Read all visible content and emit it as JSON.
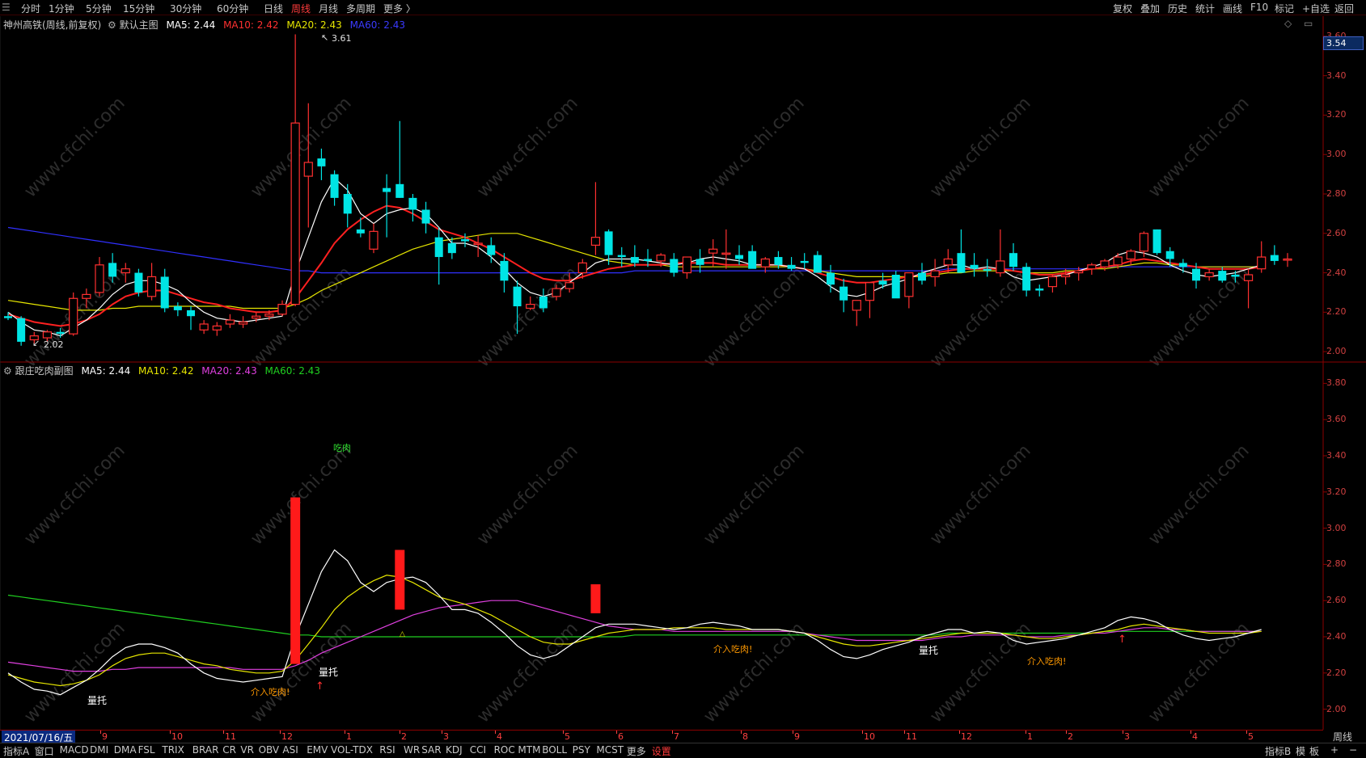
{
  "topbar": {
    "items": [
      "分时",
      "1分钟",
      "5分钟",
      "15分钟",
      "30分钟",
      "60分钟",
      "日线",
      "周线",
      "月线",
      "多周期",
      "更多 〉"
    ],
    "active": "周线",
    "right_items": [
      "复权",
      "叠加",
      "历史",
      "统计",
      "画线",
      "F10",
      "标记",
      "+自选",
      "返回"
    ]
  },
  "main_panel": {
    "stock": "神州高铁(周线,前复权)",
    "template": "默认主图",
    "ma5": "MA5: 2.44",
    "ma10": "MA10: 2.42",
    "ma20": "MA20: 2.43",
    "ma60": "MA60: 2.43",
    "high_label": "3.61",
    "low_label": "2.02",
    "price_tag": "3.54",
    "y_ticks": [
      "3.60",
      "3.40",
      "3.20",
      "3.00",
      "2.80",
      "2.60",
      "2.40",
      "2.20",
      "2.00"
    ]
  },
  "sub_panel": {
    "title": "跟庄吃肉副图",
    "ma5": "MA5: 2.44",
    "ma10": "MA10: 2.42",
    "ma20": "MA20: 2.43",
    "ma60": "MA60: 2.43",
    "y_ticks": [
      "3.80",
      "3.60",
      "3.40",
      "3.20",
      "3.00",
      "2.80",
      "2.60",
      "2.40",
      "2.20",
      "2.00"
    ],
    "annotations": {
      "chirou": "吃肉",
      "liangtuo1": "量托",
      "liangtuo2": "量托",
      "liangtuo3": "量托",
      "jieru1": "介入吃肉!",
      "jieru2": "介入吃肉!",
      "jieru3": "介入吃肉!"
    }
  },
  "date_axis": {
    "start_date": "2021/07/16/五",
    "ticks": [
      "9",
      "10",
      "11",
      "12",
      "1",
      "2",
      "3",
      "4",
      "5",
      "6",
      "7",
      "8",
      "9",
      "10",
      "11",
      "12",
      "1",
      "2",
      "3",
      "4",
      "5"
    ],
    "period_label": "周线"
  },
  "bottombar": {
    "items": [
      "指标A",
      "窗口",
      "MACD",
      "DMI",
      "DMA",
      "FSL",
      "TRIX",
      "BRAR",
      "CR",
      "VR",
      "OBV",
      "ASI",
      "EMV",
      "VOL-TDX",
      "RSI",
      "WR",
      "SAR",
      "KDJ",
      "CCI",
      "ROC",
      "MTM",
      "BOLL",
      "PSY",
      "MCST",
      "更多",
      "设置"
    ],
    "active": "设置",
    "right_items": [
      "指标B",
      "模",
      "板",
      "+",
      "−"
    ]
  },
  "watermark": "www.cfchi.com",
  "colors": {
    "up": "#ff3030",
    "down": "#00e5e5",
    "ma5": "#ffffff",
    "ma10_main": "#ff2020",
    "ma20_main": "#e6e600",
    "ma60_main": "#3030ff",
    "sub_ma10": "#e6e600",
    "sub_ma20": "#e040e0",
    "sub_ma60": "#20d020",
    "orange": "#ff9900"
  },
  "chart_data": {
    "type": "candlestick",
    "ylim_main": [
      1.98,
      3.62
    ],
    "candles": [
      [
        2.18,
        2.2,
        2.16,
        2.17
      ],
      [
        2.17,
        2.18,
        2.03,
        2.05
      ],
      [
        2.06,
        2.1,
        2.04,
        2.08
      ],
      [
        2.07,
        2.11,
        2.05,
        2.1
      ],
      [
        2.1,
        2.12,
        2.07,
        2.09
      ],
      [
        2.09,
        2.3,
        2.08,
        2.27
      ],
      [
        2.27,
        2.32,
        2.22,
        2.29
      ],
      [
        2.3,
        2.48,
        2.28,
        2.44
      ],
      [
        2.45,
        2.5,
        2.35,
        2.38
      ],
      [
        2.4,
        2.45,
        2.35,
        2.42
      ],
      [
        2.4,
        2.42,
        2.28,
        2.3
      ],
      [
        2.28,
        2.45,
        2.26,
        2.38
      ],
      [
        2.38,
        2.42,
        2.2,
        2.22
      ],
      [
        2.23,
        2.25,
        2.18,
        2.21
      ],
      [
        2.21,
        2.23,
        2.11,
        2.18
      ],
      [
        2.11,
        2.16,
        2.09,
        2.14
      ],
      [
        2.11,
        2.15,
        2.08,
        2.13
      ],
      [
        2.14,
        2.19,
        2.12,
        2.16
      ],
      [
        2.14,
        2.18,
        2.12,
        2.15
      ],
      [
        2.17,
        2.2,
        2.15,
        2.18
      ],
      [
        2.18,
        2.21,
        2.16,
        2.19
      ],
      [
        2.19,
        2.26,
        2.18,
        2.24
      ],
      [
        2.24,
        3.61,
        2.23,
        3.16
      ],
      [
        2.89,
        3.26,
        2.63,
        2.96
      ],
      [
        2.98,
        3.03,
        2.87,
        2.94
      ],
      [
        2.9,
        2.92,
        2.74,
        2.78
      ],
      [
        2.8,
        2.85,
        2.63,
        2.7
      ],
      [
        2.62,
        2.68,
        2.58,
        2.6
      ],
      [
        2.52,
        2.65,
        2.5,
        2.61
      ],
      [
        2.83,
        2.9,
        2.58,
        2.81
      ],
      [
        2.85,
        3.17,
        2.78,
        2.78
      ],
      [
        2.78,
        2.8,
        2.66,
        2.72
      ],
      [
        2.72,
        2.76,
        2.6,
        2.65
      ],
      [
        2.58,
        2.63,
        2.34,
        2.48
      ],
      [
        2.55,
        2.58,
        2.47,
        2.5
      ],
      [
        2.57,
        2.6,
        2.53,
        2.56
      ],
      [
        2.55,
        2.59,
        2.48,
        2.55
      ],
      [
        2.54,
        2.58,
        2.45,
        2.49
      ],
      [
        2.46,
        2.5,
        2.3,
        2.36
      ],
      [
        2.33,
        2.36,
        2.09,
        2.23
      ],
      [
        2.22,
        2.28,
        2.21,
        2.24
      ],
      [
        2.28,
        2.32,
        2.2,
        2.22
      ],
      [
        2.28,
        2.34,
        2.26,
        2.32
      ],
      [
        2.32,
        2.4,
        2.3,
        2.35
      ],
      [
        2.4,
        2.47,
        2.37,
        2.45
      ],
      [
        2.54,
        2.86,
        2.49,
        2.58
      ],
      [
        2.61,
        2.62,
        2.44,
        2.49
      ],
      [
        2.49,
        2.53,
        2.43,
        2.48
      ],
      [
        2.48,
        2.54,
        2.43,
        2.45
      ],
      [
        2.47,
        2.52,
        2.43,
        2.46
      ],
      [
        2.46,
        2.5,
        2.43,
        2.49
      ],
      [
        2.47,
        2.5,
        2.38,
        2.4
      ],
      [
        2.4,
        2.48,
        2.37,
        2.48
      ],
      [
        2.47,
        2.52,
        2.4,
        2.44
      ],
      [
        2.5,
        2.57,
        2.43,
        2.52
      ],
      [
        2.5,
        2.62,
        2.42,
        2.5
      ],
      [
        2.49,
        2.54,
        2.44,
        2.47
      ],
      [
        2.51,
        2.54,
        2.44,
        2.42
      ],
      [
        2.43,
        2.48,
        2.4,
        2.47
      ],
      [
        2.48,
        2.51,
        2.42,
        2.44
      ],
      [
        2.44,
        2.48,
        2.41,
        2.42
      ],
      [
        2.46,
        2.5,
        2.42,
        2.45
      ],
      [
        2.49,
        2.51,
        2.4,
        2.4
      ],
      [
        2.4,
        2.44,
        2.3,
        2.34
      ],
      [
        2.33,
        2.37,
        2.2,
        2.26
      ],
      [
        2.21,
        2.24,
        2.13,
        2.26
      ],
      [
        2.26,
        2.32,
        2.17,
        2.35
      ],
      [
        2.36,
        2.4,
        2.32,
        2.34
      ],
      [
        2.39,
        2.41,
        2.28,
        2.27
      ],
      [
        2.28,
        2.38,
        2.22,
        2.4
      ],
      [
        2.4,
        2.45,
        2.34,
        2.36
      ],
      [
        2.38,
        2.47,
        2.33,
        2.41
      ],
      [
        2.44,
        2.52,
        2.4,
        2.47
      ],
      [
        2.5,
        2.62,
        2.42,
        2.4
      ],
      [
        2.44,
        2.5,
        2.38,
        2.42
      ],
      [
        2.42,
        2.47,
        2.38,
        2.41
      ],
      [
        2.4,
        2.62,
        2.38,
        2.46
      ],
      [
        2.5,
        2.55,
        2.41,
        2.43
      ],
      [
        2.43,
        2.45,
        2.28,
        2.31
      ],
      [
        2.32,
        2.34,
        2.28,
        2.31
      ],
      [
        2.33,
        2.39,
        2.3,
        2.38
      ],
      [
        2.38,
        2.42,
        2.34,
        2.39
      ],
      [
        2.4,
        2.43,
        2.36,
        2.41
      ],
      [
        2.42,
        2.45,
        2.39,
        2.44
      ],
      [
        2.43,
        2.47,
        2.41,
        2.46
      ],
      [
        2.44,
        2.5,
        2.42,
        2.48
      ],
      [
        2.47,
        2.52,
        2.44,
        2.51
      ],
      [
        2.51,
        2.61,
        2.48,
        2.6
      ],
      [
        2.62,
        2.62,
        2.49,
        2.5
      ],
      [
        2.51,
        2.53,
        2.43,
        2.47
      ],
      [
        2.45,
        2.47,
        2.4,
        2.43
      ],
      [
        2.42,
        2.45,
        2.32,
        2.36
      ],
      [
        2.38,
        2.42,
        2.36,
        2.4
      ],
      [
        2.41,
        2.43,
        2.35,
        2.36
      ],
      [
        2.39,
        2.41,
        2.35,
        2.38
      ],
      [
        2.36,
        2.42,
        2.22,
        2.39
      ],
      [
        2.42,
        2.56,
        2.4,
        2.48
      ],
      [
        2.49,
        2.54,
        2.44,
        2.46
      ],
      [
        2.47,
        2.5,
        2.43,
        2.47
      ]
    ],
    "ma5": [
      2.2,
      2.15,
      2.11,
      2.1,
      2.08,
      2.12,
      2.16,
      2.22,
      2.29,
      2.34,
      2.36,
      2.36,
      2.34,
      2.31,
      2.25,
      2.2,
      2.17,
      2.16,
      2.15,
      2.16,
      2.17,
      2.18,
      2.4,
      2.58,
      2.76,
      2.88,
      2.82,
      2.7,
      2.65,
      2.7,
      2.72,
      2.73,
      2.7,
      2.63,
      2.55,
      2.55,
      2.53,
      2.48,
      2.42,
      2.35,
      2.3,
      2.28,
      2.3,
      2.35,
      2.4,
      2.45,
      2.47,
      2.47,
      2.47,
      2.46,
      2.45,
      2.44,
      2.45,
      2.47,
      2.48,
      2.47,
      2.46,
      2.44,
      2.44,
      2.44,
      2.43,
      2.42,
      2.38,
      2.33,
      2.29,
      2.28,
      2.3,
      2.33,
      2.35,
      2.37,
      2.4,
      2.42,
      2.44,
      2.44,
      2.42,
      2.43,
      2.42,
      2.38,
      2.36,
      2.37,
      2.38,
      2.39,
      2.41,
      2.43,
      2.45,
      2.49,
      2.51,
      2.5,
      2.48,
      2.44,
      2.41,
      2.39,
      2.38,
      2.39,
      2.4,
      2.42,
      2.44
    ],
    "ma10_main": [
      2.19,
      2.17,
      2.15,
      2.14,
      2.13,
      2.14,
      2.16,
      2.19,
      2.24,
      2.28,
      2.3,
      2.31,
      2.31,
      2.29,
      2.27,
      2.25,
      2.24,
      2.22,
      2.21,
      2.2,
      2.2,
      2.21,
      2.27,
      2.36,
      2.45,
      2.55,
      2.62,
      2.67,
      2.71,
      2.74,
      2.73,
      2.7,
      2.66,
      2.62,
      2.6,
      2.58,
      2.55,
      2.52,
      2.48,
      2.44,
      2.4,
      2.37,
      2.36,
      2.36,
      2.38,
      2.4,
      2.42,
      2.43,
      2.44,
      2.44,
      2.44,
      2.45,
      2.45,
      2.45,
      2.45,
      2.44,
      2.44,
      2.44,
      2.44,
      2.44,
      2.43,
      2.42,
      2.4,
      2.38,
      2.36,
      2.35,
      2.35,
      2.36,
      2.37,
      2.38,
      2.39,
      2.4,
      2.41,
      2.42,
      2.42,
      2.42,
      2.42,
      2.41,
      2.4,
      2.39,
      2.39,
      2.4,
      2.41,
      2.42,
      2.43,
      2.44,
      2.46,
      2.47,
      2.46,
      2.45,
      2.44,
      2.43,
      2.42,
      2.42,
      2.42,
      2.42,
      2.43
    ],
    "ma20_main": [
      2.26,
      2.25,
      2.24,
      2.23,
      2.22,
      2.21,
      2.21,
      2.21,
      2.22,
      2.22,
      2.23,
      2.23,
      2.23,
      2.23,
      2.23,
      2.23,
      2.23,
      2.23,
      2.22,
      2.22,
      2.22,
      2.22,
      2.24,
      2.27,
      2.31,
      2.34,
      2.37,
      2.4,
      2.43,
      2.46,
      2.49,
      2.52,
      2.54,
      2.56,
      2.57,
      2.58,
      2.59,
      2.6,
      2.6,
      2.6,
      2.58,
      2.56,
      2.54,
      2.52,
      2.5,
      2.48,
      2.46,
      2.45,
      2.44,
      2.44,
      2.44,
      2.43,
      2.43,
      2.43,
      2.43,
      2.43,
      2.43,
      2.43,
      2.43,
      2.43,
      2.43,
      2.42,
      2.41,
      2.4,
      2.39,
      2.38,
      2.38,
      2.38,
      2.38,
      2.38,
      2.38,
      2.39,
      2.4,
      2.4,
      2.41,
      2.41,
      2.41,
      2.41,
      2.4,
      2.4,
      2.4,
      2.41,
      2.41,
      2.42,
      2.42,
      2.43,
      2.44,
      2.45,
      2.45,
      2.44,
      2.44,
      2.43,
      2.43,
      2.43,
      2.43,
      2.43,
      2.43
    ],
    "ma60_main": [
      2.63,
      2.62,
      2.61,
      2.6,
      2.59,
      2.58,
      2.57,
      2.56,
      2.55,
      2.54,
      2.53,
      2.52,
      2.51,
      2.5,
      2.49,
      2.48,
      2.47,
      2.46,
      2.45,
      2.44,
      2.43,
      2.42,
      2.41,
      2.41,
      2.4,
      2.4,
      2.4,
      2.4,
      2.4,
      2.4,
      2.4,
      2.4,
      2.4,
      2.4,
      2.4,
      2.4,
      2.4,
      2.4,
      2.4,
      2.4,
      2.4,
      2.4,
      2.4,
      2.4,
      2.4,
      2.4,
      2.4,
      2.4,
      2.41,
      2.41,
      2.41,
      2.41,
      2.41,
      2.41,
      2.41,
      2.41,
      2.41,
      2.41,
      2.41,
      2.41,
      2.41,
      2.41,
      2.41,
      2.41,
      2.41,
      2.41,
      2.41,
      2.41,
      2.41,
      2.41,
      2.41,
      2.41,
      2.42,
      2.42,
      2.42,
      2.42,
      2.42,
      2.42,
      2.42,
      2.42,
      2.42,
      2.42,
      2.42,
      2.42,
      2.43,
      2.43,
      2.43,
      2.43,
      2.43,
      2.43,
      2.43,
      2.43,
      2.43,
      2.43,
      2.43,
      2.43,
      2.43
    ],
    "ylim_sub": [
      1.9,
      3.9
    ],
    "sub_bars": [
      [
        22,
        2.25,
        3.17
      ],
      [
        30,
        2.55,
        2.88
      ],
      [
        45,
        2.53,
        2.69
      ]
    ]
  }
}
